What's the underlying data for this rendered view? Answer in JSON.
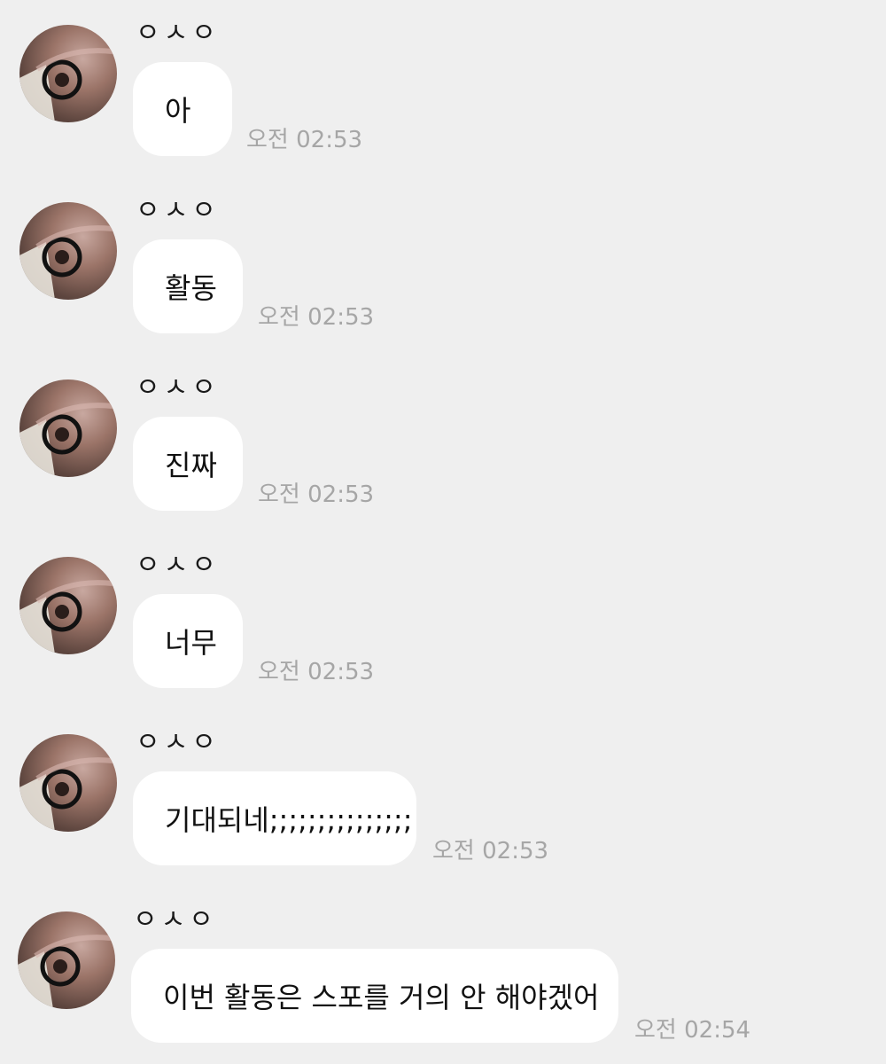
{
  "messages": [
    {
      "sender": "ㅇㅅㅇ",
      "text": "아",
      "time": "오전 02:53"
    },
    {
      "sender": "ㅇㅅㅇ",
      "text": "활동",
      "time": "오전 02:53"
    },
    {
      "sender": "ㅇㅅㅇ",
      "text": "진짜",
      "time": "오전 02:53"
    },
    {
      "sender": "ㅇㅅㅇ",
      "text": "너무",
      "time": "오전 02:53"
    },
    {
      "sender": "ㅇㅅㅇ",
      "text": "기대되네;;;;;;;;;;;;;;;",
      "time": "오전 02:53"
    },
    {
      "sender": "ㅇㅅㅇ",
      "text": "이번 활동은 스포를 거의 안 해야겠어",
      "time": "오전 02:54"
    }
  ]
}
